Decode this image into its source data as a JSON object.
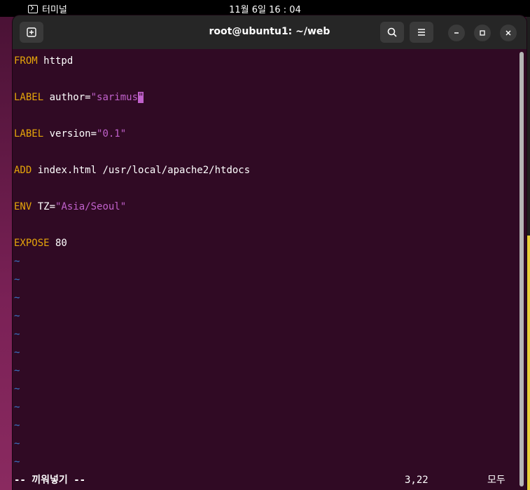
{
  "topbar": {
    "app_name": "터미널",
    "clock": "11월 6일  16 : 04"
  },
  "window": {
    "title": "root@ubuntu1: ~/web"
  },
  "editor": {
    "lines": [
      {
        "keyword": "FROM",
        "rest": " httpd",
        "string": "",
        "after": ""
      },
      {
        "keyword": "LABEL",
        "rest": " author=",
        "string": "\"sarimus",
        "after": "\""
      },
      {
        "keyword": "LABEL",
        "rest": " version=",
        "string": "\"0.1\"",
        "after": ""
      },
      {
        "keyword": "ADD",
        "rest": " index.html /usr/local/apache2/htdocs",
        "string": "",
        "after": ""
      },
      {
        "keyword": "ENV",
        "rest": " TZ=",
        "string": "\"Asia/Seoul\"",
        "after": ""
      },
      {
        "keyword": "EXPOSE",
        "rest": " 80",
        "string": "",
        "after": ""
      }
    ],
    "tilde": "~",
    "tilde_count": 12
  },
  "status": {
    "mode": "-- 끼워넣기 --",
    "position": "3,22",
    "scroll": "모두"
  },
  "colors": {
    "background": "#300a24",
    "keyword": "#e5a50a",
    "string": "#c061cb",
    "tilde": "#3a78c9"
  }
}
